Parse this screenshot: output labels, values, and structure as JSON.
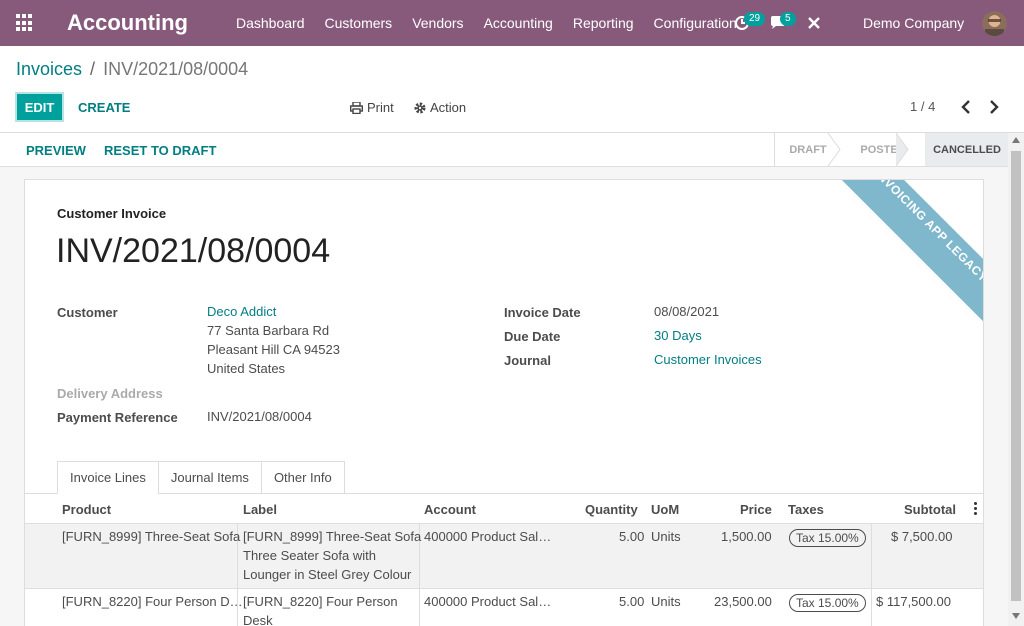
{
  "topbar": {
    "app_title": "Accounting",
    "menu": [
      "Dashboard",
      "Customers",
      "Vendors",
      "Accounting",
      "Reporting",
      "Configuration"
    ],
    "activity_count": "29",
    "messages_count": "5",
    "company": "Demo Company",
    "colors": {
      "bar": "#875a7b",
      "badge": "#00a09d"
    }
  },
  "breadcrumb": {
    "parent": "Invoices",
    "separator": "/",
    "current": "INV/2021/08/0004"
  },
  "control": {
    "edit_label": "EDIT",
    "create_label": "CREATE",
    "print_label": "Print",
    "action_label": "Action",
    "pager": "1 / 4"
  },
  "statusbar": {
    "preview_label": "PREVIEW",
    "reset_label": "RESET TO DRAFT",
    "stages": [
      "DRAFT",
      "POSTED",
      "CANCELLED"
    ],
    "active_stage": "CANCELLED"
  },
  "form": {
    "ribbon": "INVOICING APP LEGACY",
    "type_label": "Customer Invoice",
    "number": "INV/2021/08/0004",
    "customer_label": "Customer",
    "customer_name": "Deco Addict",
    "customer_address": [
      "77 Santa Barbara Rd",
      "Pleasant Hill CA 94523",
      "United States"
    ],
    "delivery_label": "Delivery Address",
    "payment_ref_label": "Payment Reference",
    "payment_ref": "INV/2021/08/0004",
    "invoice_date_label": "Invoice Date",
    "invoice_date": "08/08/2021",
    "due_date_label": "Due Date",
    "due_date": "30 Days",
    "journal_label": "Journal",
    "journal": "Customer Invoices"
  },
  "tabs": [
    "Invoice Lines",
    "Journal Items",
    "Other Info"
  ],
  "table": {
    "headers": [
      "Product",
      "Label",
      "Account",
      "Quantity",
      "UoM",
      "Price",
      "Taxes",
      "Subtotal"
    ],
    "rows": [
      {
        "product": "[FURN_8999] Three-Seat Sofa",
        "label_lines": [
          "[FURN_8999] Three-Seat Sofa",
          "Three Seater Sofa with",
          "Lounger in Steel Grey Colour"
        ],
        "account": "400000 Product Sal…",
        "quantity": "5.00",
        "uom": "Units",
        "price": "1,500.00",
        "tax": "Tax 15.00%",
        "subtotal": "$ 7,500.00"
      },
      {
        "product": "[FURN_8220] Four Person D…",
        "label_lines": [
          "[FURN_8220] Four Person",
          "Desk"
        ],
        "account": "400000 Product Sal…",
        "quantity": "5.00",
        "uom": "Units",
        "price": "23,500.00",
        "tax": "Tax 15.00%",
        "subtotal": "$ 117,500.00"
      }
    ]
  }
}
